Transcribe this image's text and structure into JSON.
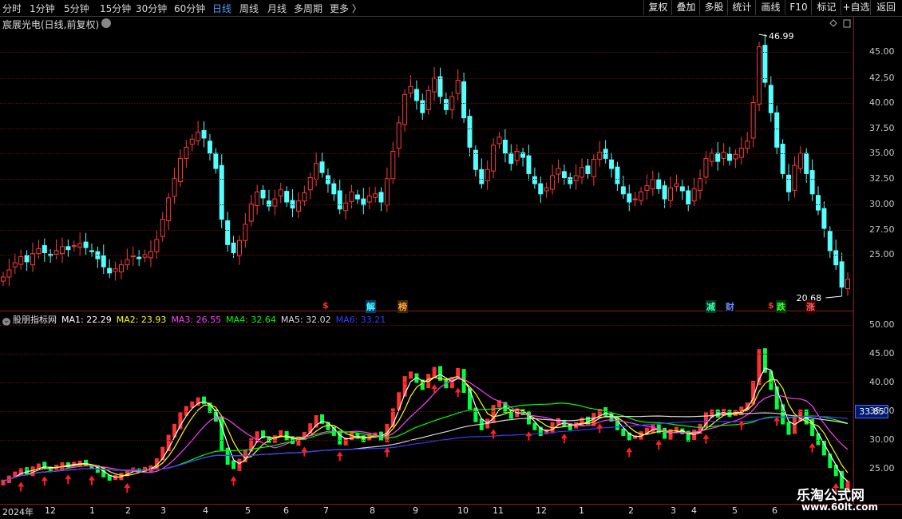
{
  "toolbar": {
    "periods": [
      "分时",
      "1分钟",
      "5分钟",
      "15分钟",
      "30分钟",
      "60分钟",
      "日线",
      "周线",
      "月线",
      "多周期",
      "更多 〉"
    ],
    "active_period": "日线",
    "buttons": [
      "复权",
      "叠加",
      "多股",
      "统计",
      "画线",
      "F10",
      "标记",
      "+自选",
      "返回"
    ]
  },
  "stock": {
    "title": "宸展光电(日线,前复权)"
  },
  "price_axis": [
    "45.00",
    "42.50",
    "40.00",
    "37.50",
    "35.00",
    "32.50",
    "30.00",
    "27.50",
    "25.00"
  ],
  "price_max_label": "46.99",
  "price_min_label": "20.68",
  "indicator": {
    "name": "股朋指标网",
    "ma": [
      {
        "label": "MA1: 22.29",
        "color": "#ffffff"
      },
      {
        "label": "MA2: 23.93",
        "color": "#ffff00"
      },
      {
        "label": "MA3: 26.55",
        "color": "#ff40ff"
      },
      {
        "label": "MA4: 32.64",
        "color": "#00ff00"
      },
      {
        "label": "MA5: 32.02",
        "color": "#d8d8d8"
      },
      {
        "label": "MA6: 33.21",
        "color": "#3a3aff"
      }
    ],
    "axis": [
      "50.00",
      "45.00",
      "40.00",
      "35.00",
      "30.00",
      "25.00"
    ],
    "current_value": "33.85"
  },
  "events": [
    {
      "label": "$",
      "color": "#ff3030",
      "bg": "#000"
    },
    {
      "label": "解",
      "color": "#40ffff",
      "bg": "#0a3a6a"
    },
    {
      "label": "榜",
      "color": "#ffa040",
      "bg": "#3a2a00"
    },
    {
      "label": "减",
      "color": "#40ffa0",
      "bg": "#003a2a"
    },
    {
      "label": "财",
      "color": "#6a8aff",
      "bg": "#000"
    },
    {
      "label": "$",
      "color": "#ff3030",
      "bg": "#000"
    },
    {
      "label": "跌",
      "color": "#40ff40",
      "bg": "#003a00"
    },
    {
      "label": "涨",
      "color": "#ff6060",
      "bg": "#3a0000"
    }
  ],
  "months": [
    "2024年",
    "12",
    "1",
    "2",
    "3",
    "4",
    "5",
    "6",
    "7",
    "8",
    "9",
    "10",
    "11",
    "12",
    "1",
    "2",
    "3",
    "4",
    "5",
    "6"
  ],
  "watermark": {
    "line1": "乐淘公式网",
    "line2": "www.60lt.com"
  },
  "chart_data": {
    "type": "candlestick",
    "closes": [
      22.8,
      23.5,
      24.2,
      24.8,
      24.3,
      25.1,
      25.6,
      25.2,
      24.9,
      25.4,
      25.8,
      25.5,
      25.9,
      26.1,
      25.7,
      25.3,
      24.6,
      23.8,
      23.2,
      23.6,
      24.0,
      24.5,
      24.9,
      24.6,
      25.0,
      25.3,
      26.5,
      28.5,
      30.6,
      32.5,
      34.5,
      35.6,
      36.4,
      37.1,
      36.5,
      35.0,
      33.5,
      28.5,
      26.0,
      25.2,
      26.4,
      28.0,
      30.0,
      31.2,
      30.6,
      29.8,
      30.5,
      31.4,
      30.2,
      29.6,
      30.3,
      31.1,
      32.6,
      34.0,
      33.1,
      32.0,
      31.0,
      29.5,
      30.1,
      31.2,
      30.5,
      29.9,
      30.8,
      31.0,
      30.2,
      32.5,
      35.2,
      38.0,
      40.8,
      41.6,
      40.2,
      39.0,
      41.2,
      42.4,
      40.6,
      39.3,
      40.6,
      42.2,
      38.5,
      35.6,
      33.4,
      32.0,
      33.4,
      35.8,
      36.6,
      35.0,
      34.0,
      35.2,
      34.6,
      33.0,
      32.0,
      31.0,
      31.6,
      32.8,
      33.5,
      32.6,
      32.0,
      32.8,
      33.6,
      33.0,
      34.4,
      35.1,
      34.5,
      33.5,
      32.0,
      31.0,
      30.2,
      30.5,
      31.2,
      31.8,
      32.4,
      31.5,
      30.5,
      31.6,
      32.0,
      31.3,
      30.0,
      31.5,
      32.5,
      34.5,
      35.0,
      34.2,
      35.1,
      34.3,
      34.9,
      35.5,
      36.2,
      40.0,
      45.5,
      42.0,
      39.0,
      35.6,
      33.0,
      31.2,
      33.8,
      35.0,
      33.0,
      31.0,
      29.4,
      27.6,
      25.4,
      24.0,
      21.8,
      22.6
    ],
    "price_range": [
      20.68,
      46.99
    ],
    "indicator_range": [
      22,
      51
    ]
  }
}
